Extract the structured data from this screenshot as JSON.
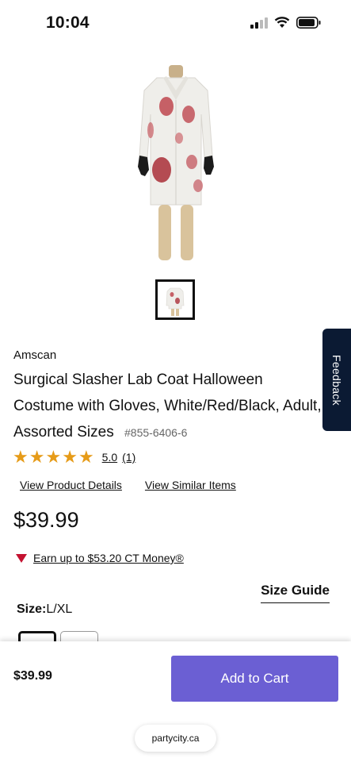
{
  "status_bar": {
    "time": "10:04"
  },
  "product": {
    "brand": "Amscan",
    "title": "Surgical Slasher Lab Coat Halloween Costume with Gloves, White/Red/Black, Adult, Assorted Sizes",
    "sku": "#855-6406-6",
    "rating": {
      "value": "5.0",
      "count": "(1)",
      "stars": 5
    },
    "links": {
      "details": "View Product Details",
      "similar": "View Similar Items"
    },
    "price": "$39.99",
    "ct_money": "Earn up to $53.20 CT Money®",
    "size_guide": "Size Guide",
    "size": {
      "label": "Size:",
      "value": "L/XL"
    }
  },
  "bottom_bar": {
    "price": "$39.99",
    "add_to_cart": "Add to Cart",
    "url": "partycity.ca"
  },
  "feedback_tab": "Feedback",
  "colors": {
    "accent": "#6b5fd3",
    "star": "#e69b18",
    "feedback_bg": "#0b1a33",
    "ct_red": "#c41230"
  }
}
